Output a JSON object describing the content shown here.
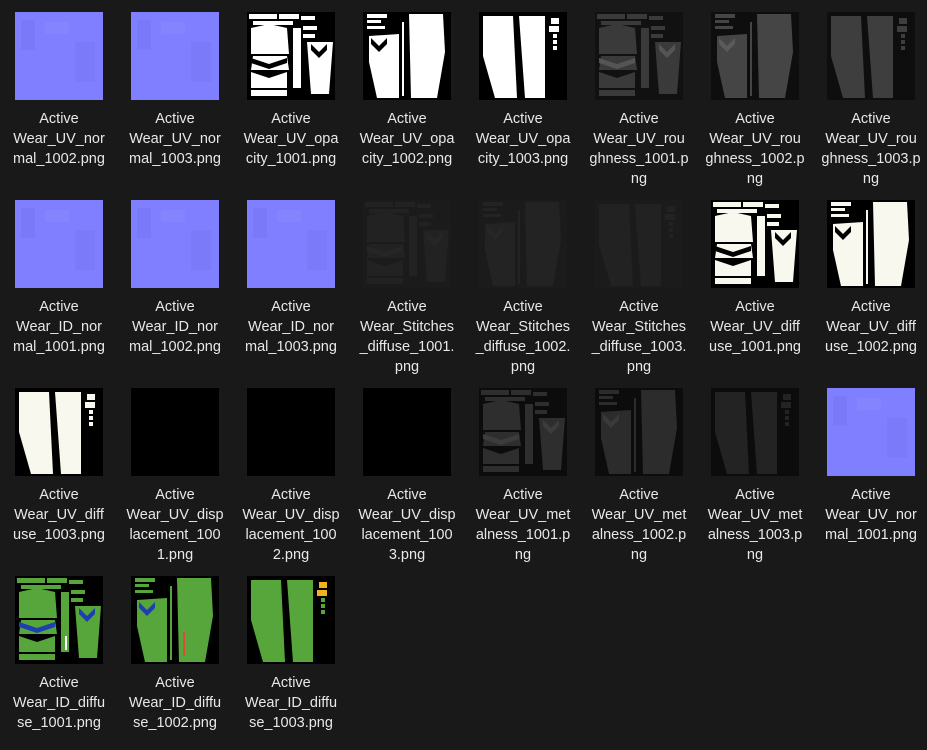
{
  "files": [
    {
      "name": "ActiveWear_UV_normal_1002.png",
      "label": "Active\nWear_UV_nor\nmal_1002.png",
      "kind": "normal"
    },
    {
      "name": "ActiveWear_UV_normal_1003.png",
      "label": "Active\nWear_UV_nor\nmal_1003.png",
      "kind": "normal"
    },
    {
      "name": "ActiveWear_UV_opacity_1001.png",
      "label": "Active\nWear_UV_opa\ncity_1001.png",
      "kind": "torso",
      "colors": {
        "bg": "#000000",
        "fg": "#ffffff",
        "accent": "#ffffff"
      }
    },
    {
      "name": "ActiveWear_UV_opacity_1002.png",
      "label": "Active\nWear_UV_opa\ncity_1002.png",
      "kind": "pants-a",
      "colors": {
        "bg": "#000000",
        "fg": "#ffffff",
        "accent": "#ffffff"
      }
    },
    {
      "name": "ActiveWear_UV_opacity_1003.png",
      "label": "Active\nWear_UV_opa\ncity_1003.png",
      "kind": "pants-b",
      "colors": {
        "bg": "#000000",
        "fg": "#ffffff",
        "accent": "#ffffff"
      }
    },
    {
      "name": "ActiveWear_UV_roughness_1001.png",
      "label": "Active\nWear_UV_rou\nghness_1001.p\nng",
      "kind": "torso",
      "colors": {
        "bg": "#111111",
        "fg": "#3a3a3a",
        "accent": "#555555"
      }
    },
    {
      "name": "ActiveWear_UV_roughness_1002.png",
      "label": "Active\nWear_UV_rou\nghness_1002.p\nng",
      "kind": "pants-a",
      "colors": {
        "bg": "#0e0e0e",
        "fg": "#454545",
        "accent": "#5a5a5a"
      }
    },
    {
      "name": "ActiveWear_UV_roughness_1003.png",
      "label": "Active\nWear_UV_rou\nghness_1003.p\nng",
      "kind": "pants-b",
      "colors": {
        "bg": "#0e0e0e",
        "fg": "#3e3e3e",
        "accent": "#555555"
      }
    },
    {
      "name": "ActiveWear_ID_normal_1001.png",
      "label": "Active\nWear_ID_nor\nmal_1001.png",
      "kind": "normal"
    },
    {
      "name": "ActiveWear_ID_normal_1002.png",
      "label": "Active\nWear_ID_nor\nmal_1002.png",
      "kind": "normal"
    },
    {
      "name": "ActiveWear_ID_normal_1003.png",
      "label": "Active\nWear_ID_nor\nmal_1003.png",
      "kind": "normal"
    },
    {
      "name": "ActiveWear_Stitches_diffuse_1001.png",
      "label": "Active\nWear_Stitches\n_diffuse_1001.\npng",
      "kind": "torso",
      "colors": {
        "bg": "#1b1b1b",
        "fg": "#222222",
        "accent": "#262626"
      }
    },
    {
      "name": "ActiveWear_Stitches_diffuse_1002.png",
      "label": "Active\nWear_Stitches\n_diffuse_1002.\npng",
      "kind": "pants-a",
      "colors": {
        "bg": "#1b1b1b",
        "fg": "#232323",
        "accent": "#272727"
      }
    },
    {
      "name": "ActiveWear_Stitches_diffuse_1003.png",
      "label": "Active\nWear_Stitches\n_diffuse_1003.\npng",
      "kind": "pants-b",
      "colors": {
        "bg": "#1b1b1b",
        "fg": "#222222",
        "accent": "#262626"
      }
    },
    {
      "name": "ActiveWear_UV_diffuse_1001.png",
      "label": "Active\nWear_UV_diff\nuse_1001.png",
      "kind": "torso",
      "colors": {
        "bg": "#000000",
        "fg": "#f8f8ee",
        "accent": "#f8f8ee"
      }
    },
    {
      "name": "ActiveWear_UV_diffuse_1002.png",
      "label": "Active\nWear_UV_diff\nuse_1002.png",
      "kind": "pants-a",
      "colors": {
        "bg": "#000000",
        "fg": "#f8f8ee",
        "accent": "#f8f8ee"
      }
    },
    {
      "name": "ActiveWear_UV_diffuse_1003.png",
      "label": "Active\nWear_UV_diff\nuse_1003.png",
      "kind": "pants-b",
      "colors": {
        "bg": "#000000",
        "fg": "#f8f8ee",
        "accent": "#f8f8ee"
      }
    },
    {
      "name": "ActiveWear_UV_displacement_1001.png",
      "label": "Active\nWear_UV_disp\nlacement_100\n1.png",
      "kind": "black"
    },
    {
      "name": "ActiveWear_UV_displacement_1002.png",
      "label": "Active\nWear_UV_disp\nlacement_100\n2.png",
      "kind": "black"
    },
    {
      "name": "ActiveWear_UV_displacement_1003.png",
      "label": "Active\nWear_UV_disp\nlacement_100\n3.png",
      "kind": "black"
    },
    {
      "name": "ActiveWear_UV_metalness_1001.png",
      "label": "Active\nWear_UV_met\nalness_1001.p\nng",
      "kind": "torso",
      "colors": {
        "bg": "#0c0c0c",
        "fg": "#2e2e2e",
        "accent": "#3c3c3c"
      }
    },
    {
      "name": "ActiveWear_UV_metalness_1002.png",
      "label": "Active\nWear_UV_met\nalness_1002.p\nng",
      "kind": "pants-a",
      "colors": {
        "bg": "#0c0c0c",
        "fg": "#2c2c2c",
        "accent": "#3a3a3a"
      }
    },
    {
      "name": "ActiveWear_UV_metalness_1003.png",
      "label": "Active\nWear_UV_met\nalness_1003.p\nng",
      "kind": "pants-b",
      "colors": {
        "bg": "#0c0c0c",
        "fg": "#232323",
        "accent": "#303030"
      }
    },
    {
      "name": "ActiveWear_UV_normal_1001.png",
      "label": "Active\nWear_UV_nor\nmal_1001.png",
      "kind": "normal"
    },
    {
      "name": "ActiveWear_ID_diffuse_1001.png",
      "label": "Active\nWear_ID_diffu\nse_1001.png",
      "kind": "torso",
      "colors": {
        "bg": "#000000",
        "fg": "#57a63c",
        "accent": "#1d3fb0",
        "mark": "#ffffff"
      }
    },
    {
      "name": "ActiveWear_ID_diffuse_1002.png",
      "label": "Active\nWear_ID_diffu\nse_1002.png",
      "kind": "pants-a",
      "colors": {
        "bg": "#000000",
        "fg": "#57a63c",
        "accent": "#1d3fb0",
        "mark": "#e04a3a"
      }
    },
    {
      "name": "ActiveWear_ID_diffuse_1003.png",
      "label": "Active\nWear_ID_diffu\nse_1003.png",
      "kind": "pants-b",
      "colors": {
        "bg": "#000000",
        "fg": "#57a63c",
        "accent": "#f2b21c",
        "mark": "#f2b21c"
      }
    }
  ],
  "colors": {
    "background": "#191919",
    "normal_map": "#7f7fff",
    "text": "#e8e8e8"
  }
}
